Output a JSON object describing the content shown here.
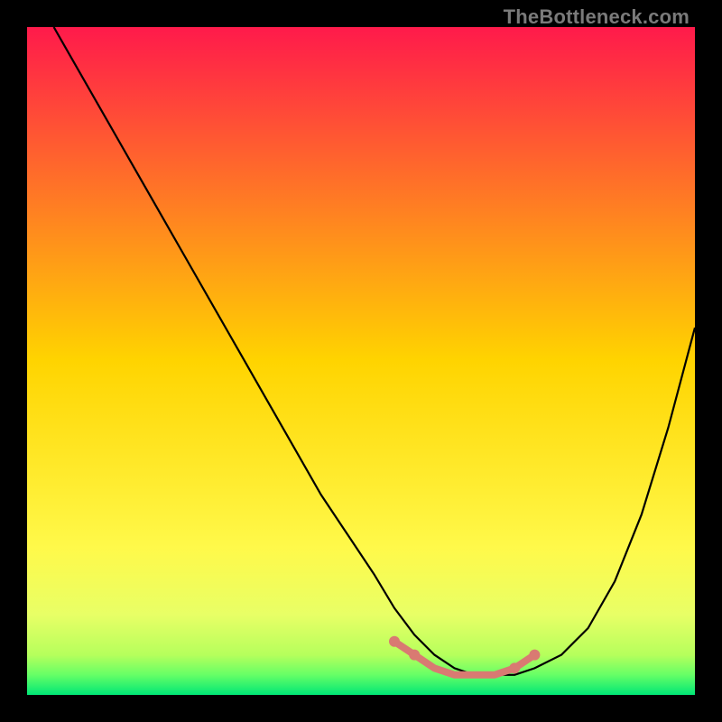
{
  "watermark": "TheBottleneck.com",
  "chart_data": {
    "type": "line",
    "title": "",
    "xlabel": "",
    "ylabel": "",
    "xlim": [
      0,
      100
    ],
    "ylim": [
      0,
      100
    ],
    "grid": false,
    "legend": false,
    "background_gradient": {
      "stops": [
        {
          "offset": 0.0,
          "color": "#ff1a4b"
        },
        {
          "offset": 0.5,
          "color": "#ffd400"
        },
        {
          "offset": 0.78,
          "color": "#fff94a"
        },
        {
          "offset": 0.88,
          "color": "#e8ff66"
        },
        {
          "offset": 0.94,
          "color": "#b6ff5c"
        },
        {
          "offset": 0.97,
          "color": "#66ff66"
        },
        {
          "offset": 1.0,
          "color": "#00e676"
        }
      ]
    },
    "series": [
      {
        "name": "bottleneck-curve",
        "stroke": "#000000",
        "x": [
          4,
          8,
          12,
          16,
          20,
          24,
          28,
          32,
          36,
          40,
          44,
          48,
          52,
          55,
          58,
          61,
          64,
          67,
          70,
          73,
          76,
          80,
          84,
          88,
          92,
          96,
          100
        ],
        "y": [
          100,
          93,
          86,
          79,
          72,
          65,
          58,
          51,
          44,
          37,
          30,
          24,
          18,
          13,
          9,
          6,
          4,
          3,
          3,
          3,
          4,
          6,
          10,
          17,
          27,
          40,
          55
        ]
      },
      {
        "name": "optimal-band-marker",
        "stroke": "#d97a72",
        "stroke_width": 8,
        "x": [
          55,
          58,
          61,
          64,
          67,
          70,
          73,
          76
        ],
        "y": [
          8,
          6,
          4,
          3,
          3,
          3,
          4,
          6
        ]
      }
    ],
    "annotations": []
  }
}
